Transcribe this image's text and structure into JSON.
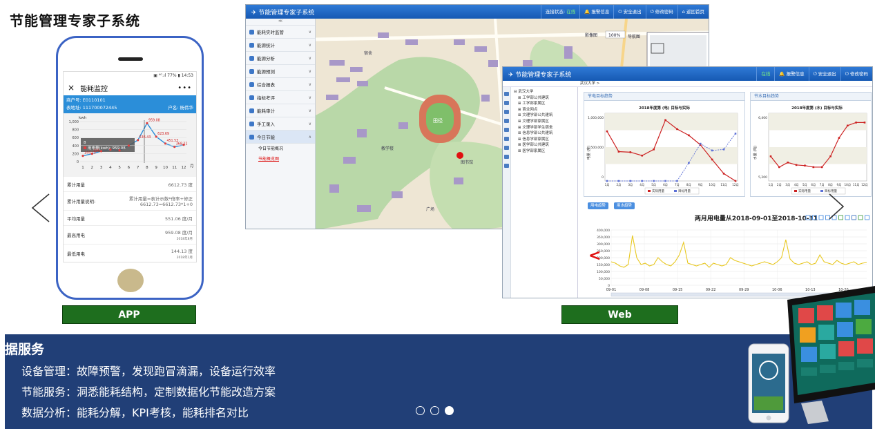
{
  "page_title": "节能管理专家子系统",
  "labels": {
    "app": "APP",
    "web": "Web"
  },
  "phone": {
    "status_bar": "▣ ⁴ᴳ.ıl 77% ▮ 14:53",
    "app_title": "能耗监控",
    "close_icon": "×",
    "more_icon": "•••",
    "account_no": "商户号: E0110101",
    "address": "表地址: 111700072445",
    "owner": "户名: 杨伟华",
    "chart": {
      "type": "line",
      "ylabel": "kwh",
      "y_ticks": [
        "1,000",
        "800",
        "600",
        "400",
        "200",
        "0"
      ],
      "x_ticks": [
        "1",
        "2",
        "3",
        "4",
        "5",
        "6",
        "7",
        "8",
        "9",
        "10",
        "11",
        "12"
      ],
      "x_unit": "月",
      "tooltip_title": "8",
      "tooltip_text": "用电量(kwh): 959.08",
      "point_labels": [
        "144.13",
        "196",
        "536.43",
        "959.08",
        "623.69",
        "451.53",
        "368.22"
      ]
    },
    "rows": [
      {
        "label": "累计用量",
        "value": "6612.73 度",
        "sub": ""
      },
      {
        "label": "累计用量说明:",
        "value": "累计用量=表计示数*倍率+修正",
        "sub": "6612.73=6612.73*1+0"
      },
      {
        "label": "平均用量",
        "value": "551.06 度/月",
        "sub": ""
      },
      {
        "label": "最高用电",
        "value": "959.08 度/月",
        "sub": "2018年8月"
      },
      {
        "label": "最低用电",
        "value": "144.13 度",
        "sub": "2018年1月"
      }
    ]
  },
  "web1": {
    "system_name": "节能管理专家子系统",
    "status_label": "连接状态:",
    "status_value": "在线",
    "buttons": [
      "报警信息",
      "安全退出",
      "修改密码",
      "返回首页"
    ],
    "collapse": "≪",
    "menu": [
      "能耗实时监管",
      "能源统计",
      "能源分析",
      "能源预测",
      "综合报表",
      "指标考评",
      "能耗审计",
      "手工录入",
      "今日节能"
    ],
    "sub_menu": [
      "今日节能概况",
      "节能概览图"
    ],
    "map_labels": {
      "layers": "影像图",
      "zoom": "100%",
      "mini_map": "导航图",
      "field": "田径",
      "place1": "宿舍",
      "place2": "教学楼",
      "place3": "广场",
      "place4": "图书馆"
    }
  },
  "web2": {
    "system_name": "节能管理专家子系统",
    "status_value": "在线",
    "buttons": [
      "报警信息",
      "安全退出",
      "修改密码"
    ],
    "breadcrumb": "武汉大学 >",
    "tree": [
      "武汉大学",
      "工学部公共建筑",
      "工学部家属区",
      "商业网点",
      "文理学部公共建筑",
      "文理学部家属区",
      "文理学部学生宿舍",
      "信息学部公共建筑",
      "信息学部家属区",
      "医学部公共建筑",
      "医学部家属区"
    ],
    "panel1_title": "节电目标趋势",
    "panel2_title": "节水目标趋势",
    "chart1": {
      "type": "line",
      "title": "2018年度第 (电) 目标与实际",
      "ylabel": "电量 (度)",
      "y_ticks": [
        "1,000,000",
        "500,000",
        "0"
      ],
      "x_ticks": [
        "1月",
        "2月",
        "3月",
        "4月",
        "5月",
        "6月",
        "7月",
        "8月",
        "9月",
        "10月",
        "11月",
        "12月"
      ],
      "series": [
        {
          "name": "实际用量",
          "values": [
            880000,
            520000,
            510000,
            450000,
            560000,
            1080000,
            920000,
            810000,
            640000,
            380000,
            130000,
            0
          ]
        },
        {
          "name": "目标用量",
          "values": [
            0,
            0,
            0,
            0,
            0,
            0,
            0,
            320000,
            660000,
            540000,
            560000,
            840000
          ]
        }
      ]
    },
    "chart2": {
      "type": "line",
      "title": "2018年度第 (水) 目标与实际",
      "ylabel": "水量 (吨)",
      "y_ticks": [
        "6,400",
        "5,200"
      ],
      "x_ticks": [
        "1月",
        "2月",
        "3月",
        "4月",
        "5月",
        "6月",
        "7月",
        "8月",
        "9月",
        "10月",
        "11月",
        "12月"
      ],
      "series": [
        {
          "name": "实际用量",
          "values": [
            5600,
            5250,
            5400,
            5320,
            5300,
            5250,
            5250,
            5600,
            6200,
            6600,
            6700,
            6700
          ]
        },
        {
          "name": "目标用量",
          "values": []
        }
      ]
    },
    "pills": [
      "用电趋势",
      "用水趋势"
    ],
    "chart3": {
      "type": "line",
      "title": "两月用电量从2018-09-01至2018-10-31",
      "y_ticks": [
        "400,000",
        "350,000",
        "300,000",
        "250,000",
        "200,000",
        "150,000",
        "100,000",
        "50,000",
        "0"
      ],
      "x_ticks": [
        "09-01",
        "09-08",
        "09-15",
        "09-22",
        "09-29",
        "10-06",
        "10-13",
        "10-20"
      ],
      "values": [
        170000,
        160000,
        140000,
        130000,
        150000,
        360000,
        200000,
        150000,
        160000,
        140000,
        150000,
        200000,
        170000,
        150000,
        140000,
        170000,
        220000,
        310000,
        160000,
        150000,
        140000,
        150000,
        160000,
        130000,
        160000,
        150000,
        140000,
        150000,
        200000,
        180000,
        170000,
        160000,
        150000,
        140000,
        150000,
        160000,
        170000,
        160000,
        150000,
        170000,
        200000,
        330000,
        190000,
        160000,
        150000,
        160000,
        170000,
        150000,
        160000,
        220000,
        170000,
        160000,
        150000,
        180000,
        160000,
        150000,
        160000,
        170000,
        150000,
        160000,
        165000
      ]
    }
  },
  "banner": {
    "title": "据服务",
    "lines": [
      "设备管理：故障预警，发现跑冒滴漏，设备运行效率",
      "节能服务：洞悉能耗结构，定制数据化节能改造方案",
      "数据分析：能耗分解，KPI考核，能耗排名对比"
    ]
  },
  "red_arrow": "<",
  "colors": {
    "banner_bg": "#213f77",
    "label_bg": "#1e6e1e",
    "phone_border": "#3b63c4",
    "topbar": "#1f68c2",
    "series_actual": "#cc2020",
    "series_target": "#5b6fd6",
    "chart3_line": "#e8c820"
  }
}
